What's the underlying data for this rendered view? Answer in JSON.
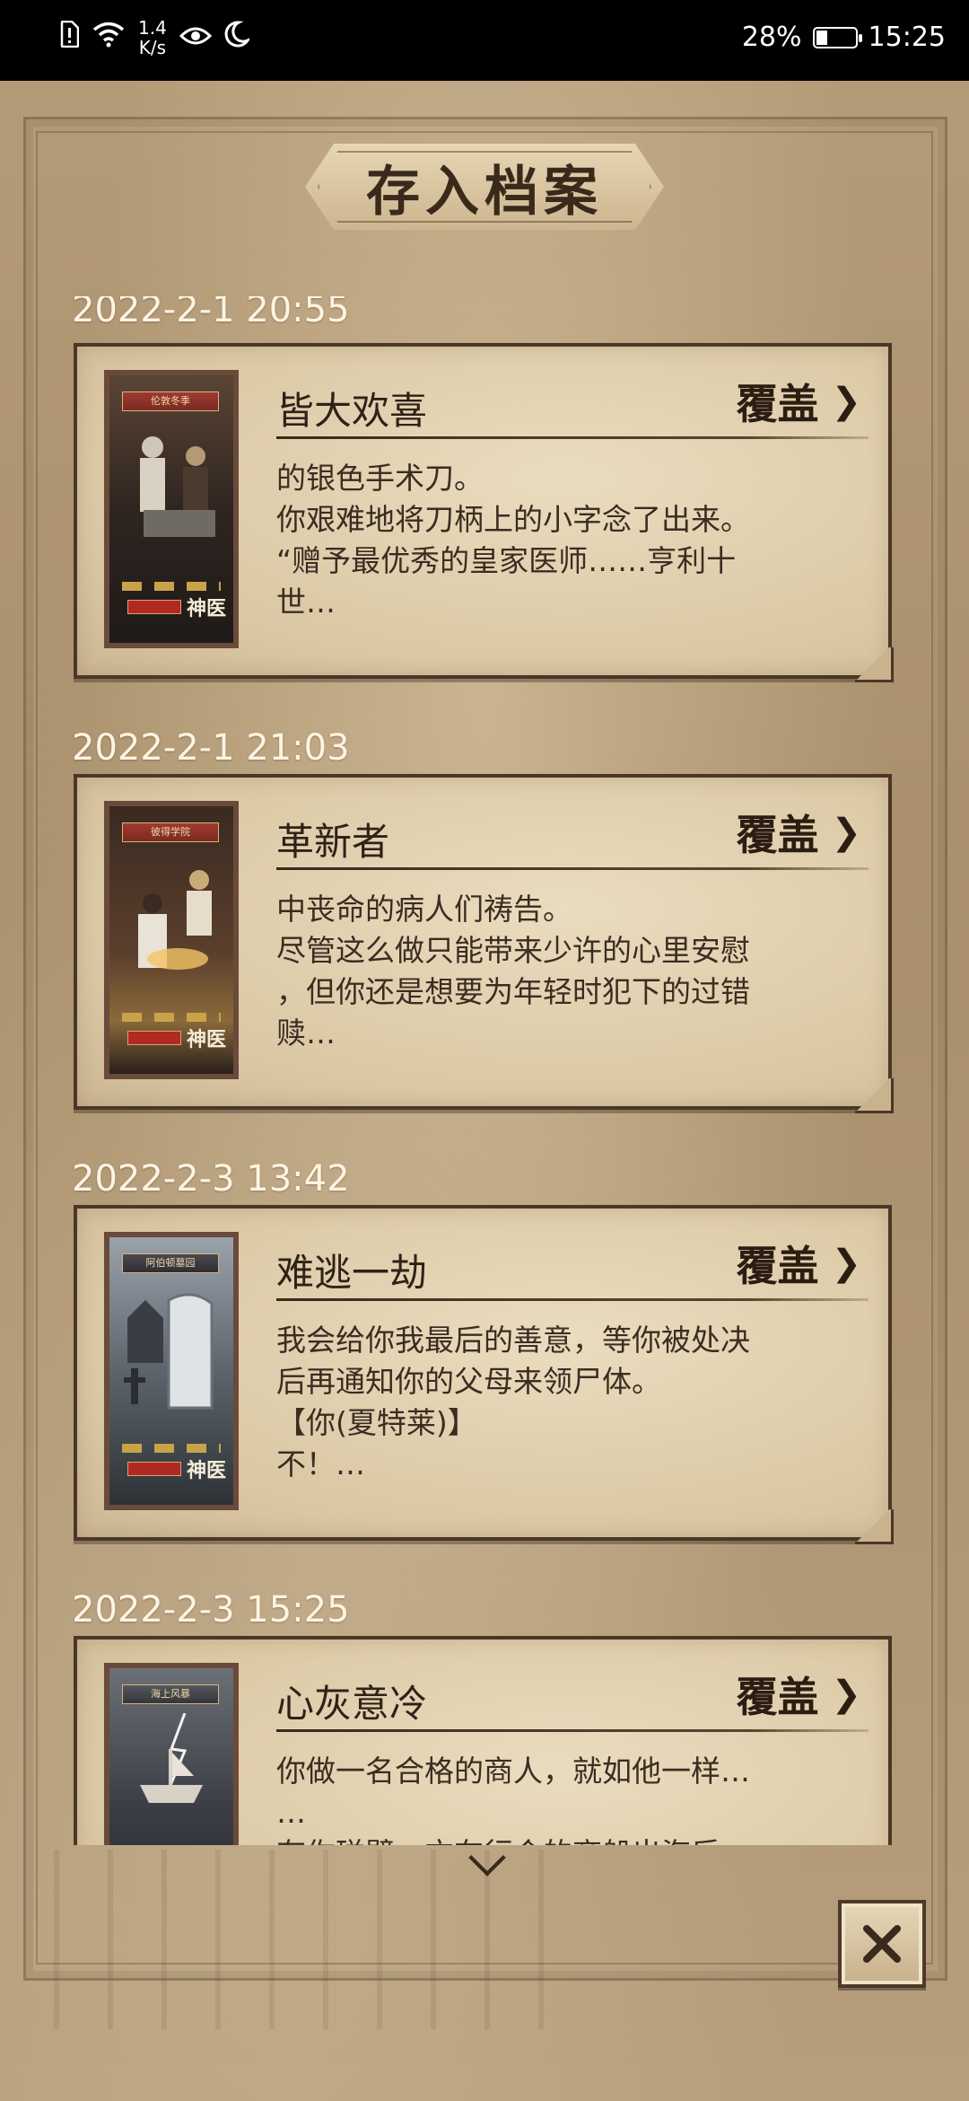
{
  "status_bar": {
    "net_speed_value": "1.4",
    "net_speed_unit": "K/s",
    "battery": "28%",
    "battery_level": 0.28,
    "time": "15:25",
    "icons": [
      "sim-alert-icon",
      "wifi-icon",
      "eye-icon",
      "moon-icon",
      "battery-icon"
    ]
  },
  "header": {
    "title": "存入档案"
  },
  "entries": [
    {
      "timestamp": "2022-2-1  20:55",
      "title": "皆大欢喜",
      "action": "覆盖",
      "thumb_banner": "伦敦冬季",
      "desc": [
        "的银色手术刀。",
        "你艰难地将刀柄上的小字念了出来。",
        "“赠予最优秀的皇家医师……亨利十",
        "世…"
      ]
    },
    {
      "timestamp": "2022-2-1  21:03",
      "title": "革新者",
      "action": "覆盖",
      "thumb_banner": "彼得学院",
      "desc": [
        "中丧命的病人们祷告。",
        "尽管这么做只能带来少许的心里安慰",
        "，但你还是想要为年轻时犯下的过错",
        "赎…"
      ]
    },
    {
      "timestamp": "2022-2-3  13:42",
      "title": "难逃一劫",
      "action": "覆盖",
      "thumb_banner": "阿伯顿墓园",
      "desc": [
        "我会给你我最后的善意，等你被处决",
        "后再通知你的父母来领尸体。",
        "【你(夏特莱)】",
        "不！…"
      ]
    },
    {
      "timestamp": "2022-2-3  15:25",
      "title": "心灰意冷",
      "action": "覆盖",
      "thumb_banner": "海上风暴",
      "desc": [
        "你做一名合格的商人，就如他一样…",
        "…",
        "有你碰壁一方在行会的商船出海后"
      ]
    }
  ],
  "thumb_logo": "神医",
  "close_button": {
    "icon": "close-icon"
  }
}
